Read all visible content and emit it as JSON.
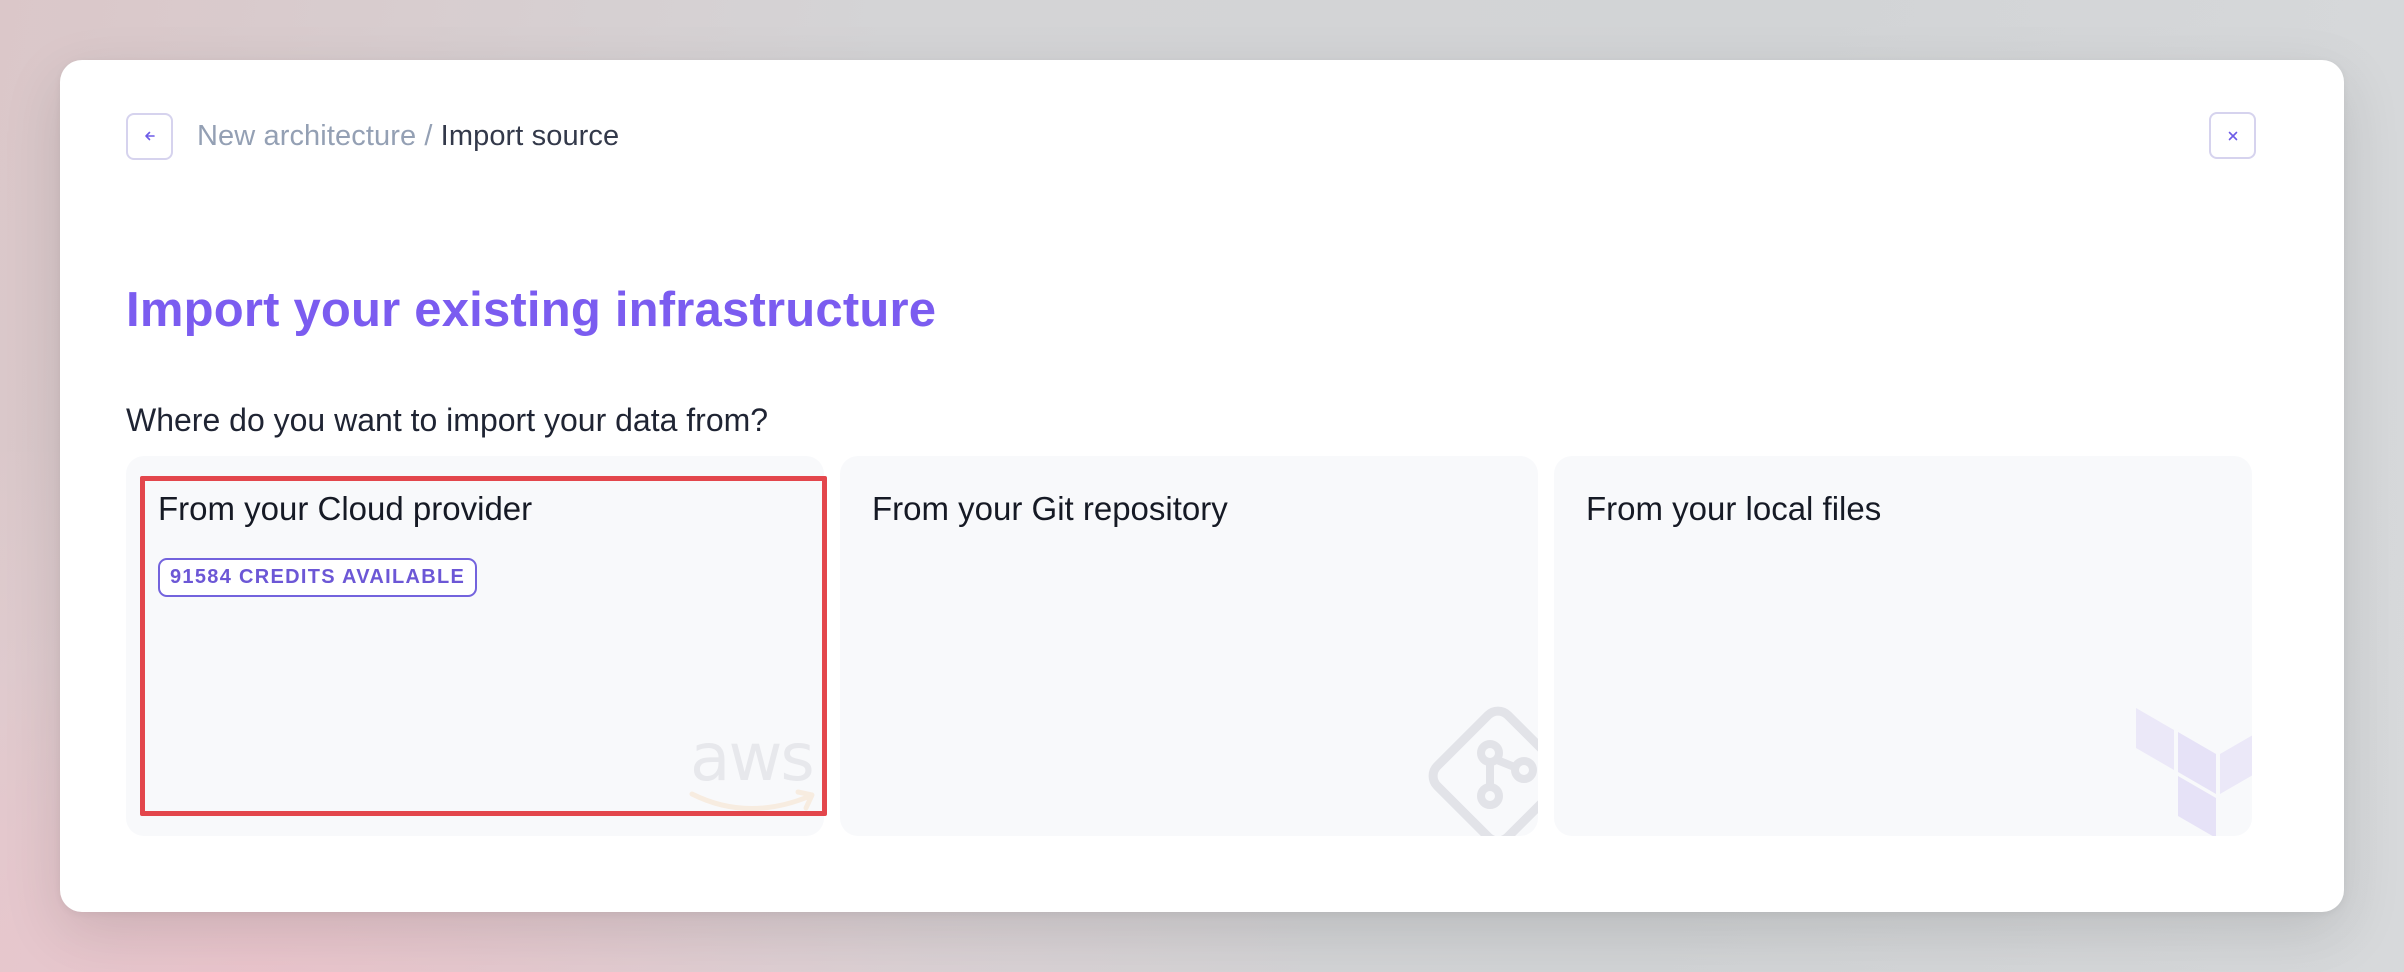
{
  "header": {
    "back_icon": "arrow-left-icon",
    "breadcrumb_parent": "New architecture",
    "breadcrumb_separator": " / ",
    "breadcrumb_current": "Import source",
    "close_icon": "close-icon"
  },
  "title": "Import your existing infrastructure",
  "subtitle": "Where do you want to import your data from?",
  "cards": [
    {
      "label": "From your Cloud provider",
      "badge": "91584 CREDITS AVAILABLE",
      "logo": "aws-logo-icon"
    },
    {
      "label": "From your Git repository",
      "logo": "git-logo-icon"
    },
    {
      "label": "From your local files",
      "logo": "terraform-logo-icon"
    }
  ],
  "colors": {
    "accent": "#7b5cf0",
    "highlight": "#e3464c",
    "card_bg": "#f8f9fb"
  }
}
